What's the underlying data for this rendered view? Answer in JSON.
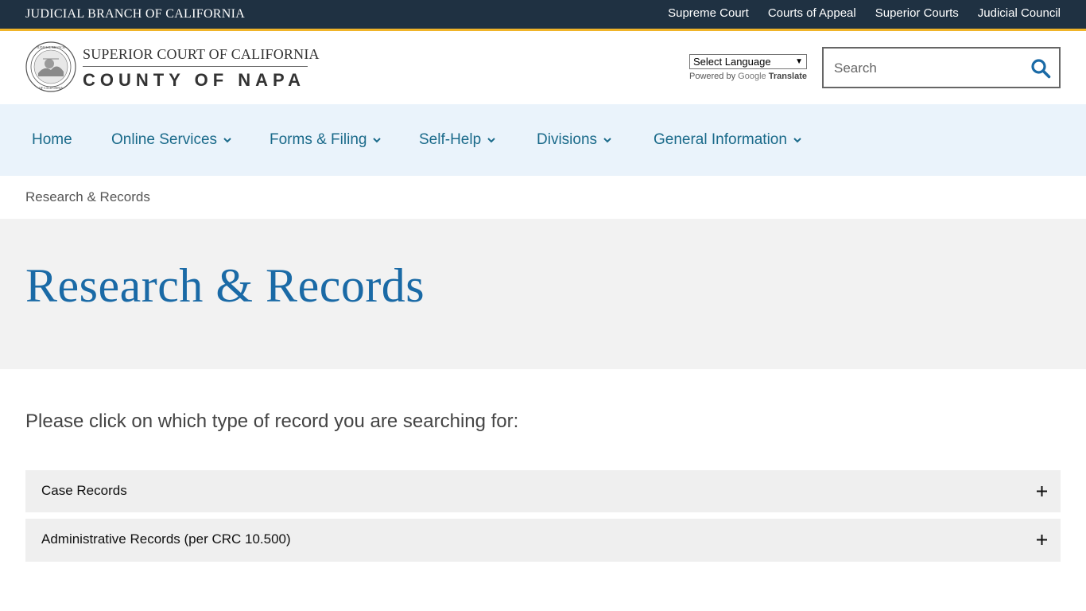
{
  "topbar": {
    "title": "JUDICIAL BRANCH OF CALIFORNIA",
    "links": [
      "Supreme Court",
      "Courts of Appeal",
      "Superior Courts",
      "Judicial Council"
    ],
    "accent_color": "#f0b429",
    "background_color": "#1f3142"
  },
  "header": {
    "court_line1": "SUPERIOR COURT OF CALIFORNIA",
    "court_line2": "COUNTY OF NAPA",
    "seal_icon": "california-judicial-seal-icon",
    "language_select": {
      "selected": "Select Language"
    },
    "powered_by": {
      "prefix": "Powered by",
      "brand": "Google",
      "product": "Translate"
    },
    "search": {
      "placeholder": "Search",
      "icon": "search-icon"
    }
  },
  "nav": {
    "items": [
      {
        "label": "Home",
        "has_dropdown": false
      },
      {
        "label": "Online Services",
        "has_dropdown": true
      },
      {
        "label": "Forms & Filing",
        "has_dropdown": true
      },
      {
        "label": "Self-Help",
        "has_dropdown": true
      },
      {
        "label": "Divisions",
        "has_dropdown": true
      },
      {
        "label": "General Information",
        "has_dropdown": true
      }
    ],
    "background_color": "#eaf3fb",
    "text_color": "#1a6a8a"
  },
  "breadcrumb": {
    "current": "Research & Records"
  },
  "hero": {
    "title": "Research & Records",
    "title_color": "#1a6aa6"
  },
  "content": {
    "intro": "Please click on which type of record you are searching for:",
    "accordions": [
      {
        "label": "Case Records",
        "icon": "plus-icon"
      },
      {
        "label": "Administrative Records (per CRC 10.500)",
        "icon": "plus-icon"
      }
    ]
  }
}
